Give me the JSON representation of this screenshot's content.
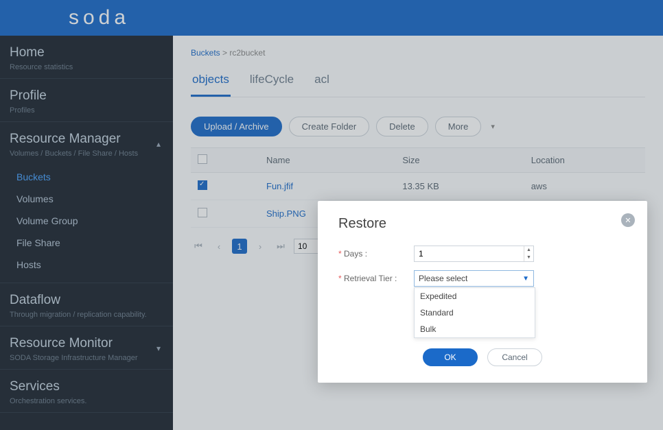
{
  "app": {
    "logo": "soda"
  },
  "sidebar": {
    "home": {
      "title": "Home",
      "sub": "Resource statistics"
    },
    "profile": {
      "title": "Profile",
      "sub": "Profiles"
    },
    "resource_manager": {
      "title": "Resource Manager",
      "sub": "Volumes / Buckets / File Share / Hosts",
      "items": [
        "Buckets",
        "Volumes",
        "Volume Group",
        "File Share",
        "Hosts"
      ]
    },
    "dataflow": {
      "title": "Dataflow",
      "sub": "Through migration / replication capability."
    },
    "resource_monitor": {
      "title": "Resource Monitor",
      "sub": "SODA Storage Infrastructure Manager"
    },
    "services": {
      "title": "Services",
      "sub": "Orchestration services."
    }
  },
  "breadcrumb": {
    "root": "Buckets",
    "sep": ">",
    "current": "rc2bucket"
  },
  "tabs": [
    "objects",
    "lifeCycle",
    "acl"
  ],
  "toolbar": {
    "upload": "Upload / Archive",
    "create_folder": "Create Folder",
    "delete": "Delete",
    "more": "More"
  },
  "table": {
    "headers": {
      "name": "Name",
      "size": "Size",
      "location": "Location"
    },
    "rows": [
      {
        "checked": true,
        "name": "Fun.jfif",
        "size": "13.35 KB",
        "location": "aws"
      },
      {
        "checked": false,
        "name": "Ship.PNG",
        "size": "",
        "location": ""
      }
    ]
  },
  "pager": {
    "page": "1",
    "size": "10"
  },
  "modal": {
    "title": "Restore",
    "days_label": "Days :",
    "days_value": "1",
    "tier_label": "Retrieval Tier :",
    "tier_placeholder": "Please select",
    "options": [
      "Expedited",
      "Standard",
      "Bulk"
    ],
    "ok": "OK",
    "cancel": "Cancel"
  }
}
